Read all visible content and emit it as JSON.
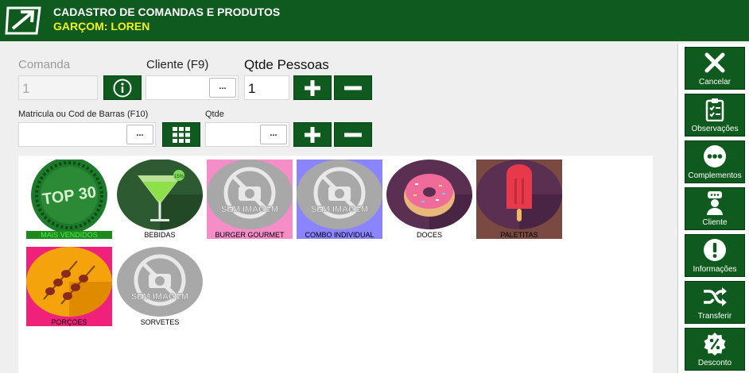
{
  "header": {
    "title": "CADASTRO DE COMANDAS E PRODUTOS",
    "subtitle": "GARÇOM: LOREN"
  },
  "form": {
    "comanda_label": "Comanda",
    "comanda_value": "1",
    "cliente_label": "Cliente (F9)",
    "cliente_value": "",
    "pessoas_label": "Qtde Pessoas",
    "pessoas_value": "1",
    "matricula_label": "Matricula ou Cod de Barras (F10)",
    "matricula_value": "",
    "qtde_label": "Qtde",
    "qtde_value": "",
    "dots_label": "..."
  },
  "categories": [
    {
      "label": "MAIS VENDIDOS",
      "icon": "top30-icon",
      "badge": "TOP 30"
    },
    {
      "label": "BEBIDAS",
      "icon": "cocktail-icon",
      "badge": "15%"
    },
    {
      "label": "BURGER GOURMET",
      "icon": "no-image-icon",
      "badge": "SEM IMAGEM"
    },
    {
      "label": "COMBO INDIVIDUAL",
      "icon": "no-image-icon",
      "badge": "SEM IMAGEM"
    },
    {
      "label": "DOCES",
      "icon": "donut-icon"
    },
    {
      "label": "PALETITAS",
      "icon": "popsicle-icon"
    },
    {
      "label": "PORÇOES",
      "icon": "skewer-icon"
    },
    {
      "label": "SORVETES",
      "icon": "no-image-icon",
      "badge": "SEM IMAGEM"
    }
  ],
  "sidebar": [
    {
      "label": "Cancelar",
      "icon": "close-icon"
    },
    {
      "label": "Observações",
      "icon": "clipboard-icon"
    },
    {
      "label": "Complementos",
      "icon": "more-icon"
    },
    {
      "label": "Cliente",
      "icon": "person-icon"
    },
    {
      "label": "Informações",
      "icon": "info-icon"
    },
    {
      "label": "Transferir",
      "icon": "shuffle-icon"
    },
    {
      "label": "Desconto",
      "icon": "discount-icon"
    }
  ],
  "colors": {
    "brand_green": "#0f5a1e",
    "subtitle_yellow": "#f2f21a"
  }
}
